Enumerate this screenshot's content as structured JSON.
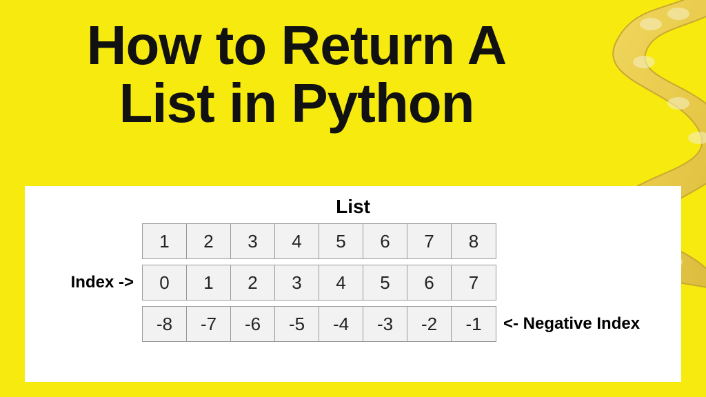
{
  "title": "How to Return A List in Python",
  "panel": {
    "heading": "List",
    "index_label": "Index ->",
    "negative_label": "<- Negative Index",
    "rows": {
      "values": [
        "1",
        "2",
        "3",
        "4",
        "5",
        "6",
        "7",
        "8"
      ],
      "index": [
        "0",
        "1",
        "2",
        "3",
        "4",
        "5",
        "6",
        "7"
      ],
      "negative": [
        "-8",
        "-7",
        "-6",
        "-5",
        "-4",
        "-3",
        "-2",
        "-1"
      ]
    }
  }
}
